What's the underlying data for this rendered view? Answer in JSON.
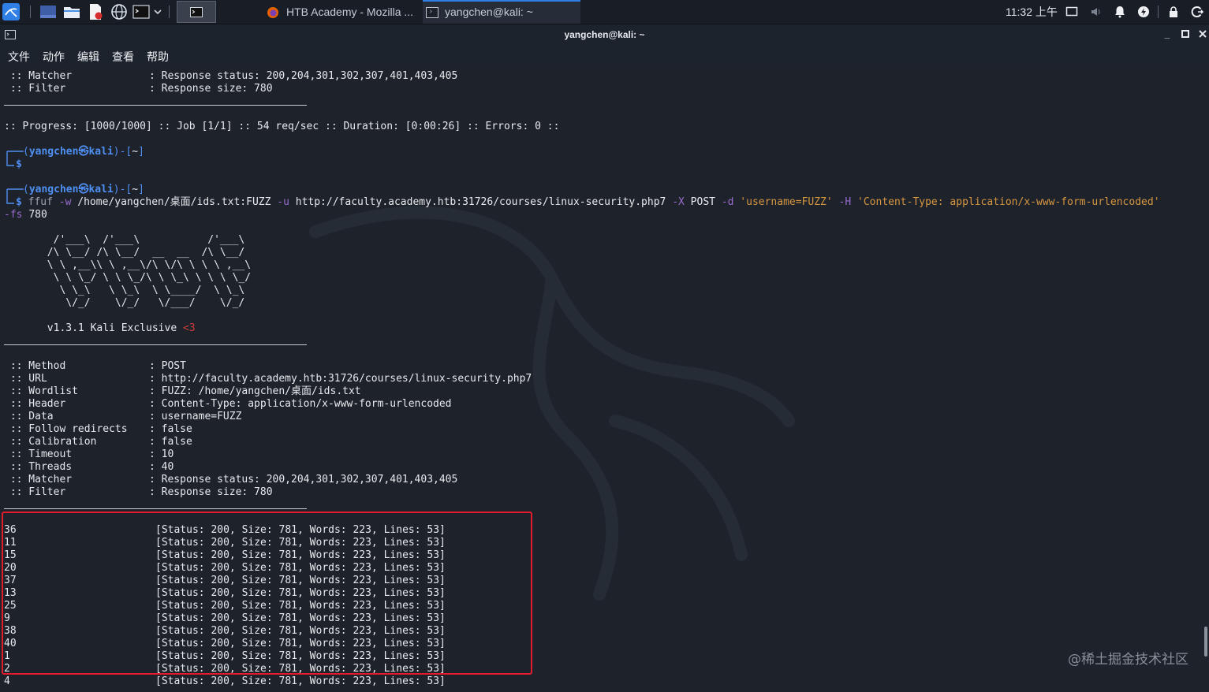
{
  "taskbar": {
    "tasks": [
      {
        "label": "HTB Academy - Mozilla ...",
        "icon": "firefox-icon"
      },
      {
        "label": "yangchen@kali: ~",
        "icon": "terminal-icon"
      }
    ],
    "clock": "11:32 上午"
  },
  "window": {
    "title": "yangchen@kali: ~",
    "menus": [
      "文件",
      "动作",
      "编辑",
      "查看",
      "帮助"
    ]
  },
  "terminal": {
    "prev_matcher_key": " :: Matcher",
    "prev_matcher_val": ": Response status: 200,204,301,302,307,401,403,405",
    "prev_filter_key": " :: Filter",
    "prev_filter_val": ": Response size: 780",
    "progress": ":: Progress: [1000/1000] :: Job [1/1] :: 54 req/sec :: Duration: [0:00:26] :: Errors: 0 ::",
    "prompt_user": "yangchen",
    "prompt_symbol": "㉿",
    "prompt_host": "kali",
    "prompt_dir": "~",
    "cmd": {
      "bin": "ffuf",
      "f_w": "-w",
      "wordlist": "/home/yangchen/桌面/ids.txt:FUZZ",
      "f_u": "-u",
      "url": "http://faculty.academy.htb:31726/courses/linux-security.php7",
      "f_X": "-X",
      "method": "POST",
      "f_d": "-d",
      "data": "'username=FUZZ'",
      "f_H": "-H",
      "header": "'Content-Type: application/x-www-form-urlencoded'",
      "f_fs": "-fs",
      "fs": "780"
    },
    "banner": [
      "        /'___\\  /'___\\           /'___\\",
      "       /\\ \\__/ /\\ \\__/  __  __  /\\ \\__/",
      "       \\ \\ ,__\\\\ \\ ,__\\/\\ \\/\\ \\ \\ \\ ,__\\",
      "        \\ \\ \\_/ \\ \\ \\_/\\ \\ \\_\\ \\ \\ \\ \\_/",
      "         \\ \\_\\   \\ \\_\\  \\ \\____/  \\ \\_\\",
      "          \\/_/    \\/_/   \\/___/    \\/_/"
    ],
    "version": "       v1.3.1 Kali Exclusive ",
    "heart": "<3",
    "config": [
      {
        "key": " :: Method           ",
        "val": ": POST"
      },
      {
        "key": " :: URL              ",
        "val": ": http://faculty.academy.htb:31726/courses/linux-security.php7"
      },
      {
        "key": " :: Wordlist         ",
        "val": ": FUZZ: /home/yangchen/桌面/ids.txt"
      },
      {
        "key": " :: Header           ",
        "val": ": Content-Type: application/x-www-form-urlencoded"
      },
      {
        "key": " :: Data             ",
        "val": ": username=FUZZ"
      },
      {
        "key": " :: Follow redirects ",
        "val": ": false"
      },
      {
        "key": " :: Calibration      ",
        "val": ": false"
      },
      {
        "key": " :: Timeout          ",
        "val": ": 10"
      },
      {
        "key": " :: Threads          ",
        "val": ": 40"
      },
      {
        "key": " :: Matcher          ",
        "val": ": Response status: 200,204,301,302,307,401,403,405"
      },
      {
        "key": " :: Filter           ",
        "val": ": Response size: 780"
      }
    ],
    "results": [
      {
        "id": "36",
        "status": "[Status: 200, Size: 781, Words: 223, Lines: 53]"
      },
      {
        "id": "11",
        "status": "[Status: 200, Size: 781, Words: 223, Lines: 53]"
      },
      {
        "id": "15",
        "status": "[Status: 200, Size: 781, Words: 223, Lines: 53]"
      },
      {
        "id": "20",
        "status": "[Status: 200, Size: 781, Words: 223, Lines: 53]"
      },
      {
        "id": "37",
        "status": "[Status: 200, Size: 781, Words: 223, Lines: 53]"
      },
      {
        "id": "13",
        "status": "[Status: 200, Size: 781, Words: 223, Lines: 53]"
      },
      {
        "id": "25",
        "status": "[Status: 200, Size: 781, Words: 223, Lines: 53]"
      },
      {
        "id": "9",
        "status": "[Status: 200, Size: 781, Words: 223, Lines: 53]"
      },
      {
        "id": "38",
        "status": "[Status: 200, Size: 781, Words: 223, Lines: 53]"
      },
      {
        "id": "40",
        "status": "[Status: 200, Size: 781, Words: 223, Lines: 53]"
      },
      {
        "id": "1",
        "status": "[Status: 200, Size: 781, Words: 223, Lines: 53]"
      },
      {
        "id": "2",
        "status": "[Status: 200, Size: 781, Words: 223, Lines: 53]"
      },
      {
        "id": "4",
        "status": "[Status: 200, Size: 781, Words: 223, Lines: 53]"
      }
    ]
  },
  "watermark": "@稀土掘金技术社区",
  "colors": {
    "prompt": "#4f8ff2",
    "flag": "#9a6ccf",
    "string": "#d79640",
    "highlight": "#e21c2b"
  }
}
